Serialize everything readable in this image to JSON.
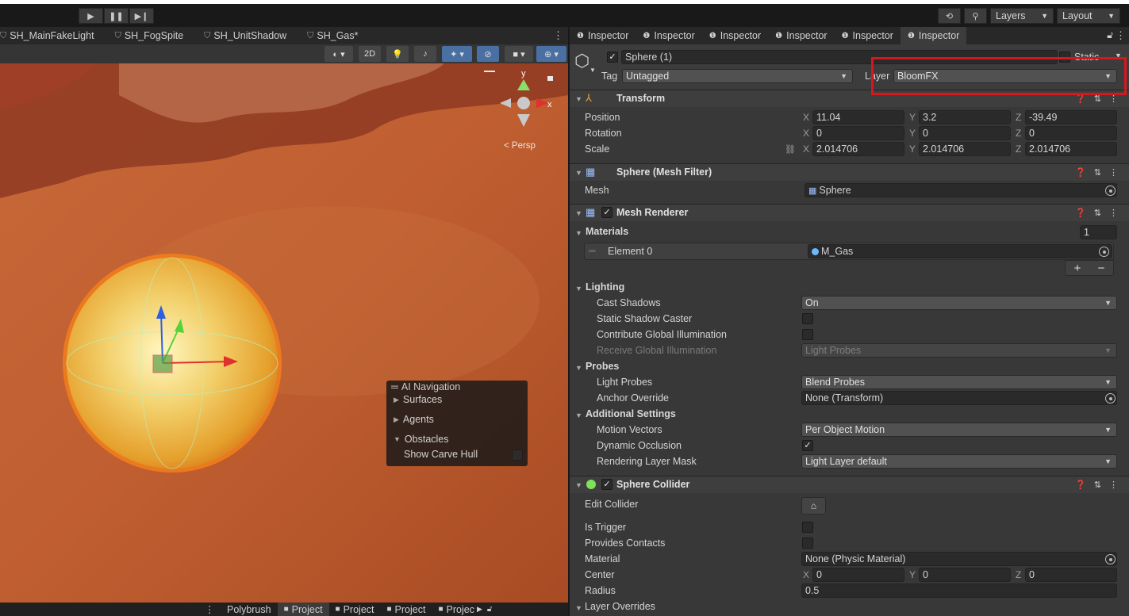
{
  "toolbar": {
    "play_icon": "play-icon",
    "pause_icon": "pause-icon",
    "step_icon": "step-icon",
    "history_icon": "history-icon",
    "search_icon": "search-icon",
    "layers_label": "Layers",
    "layout_label": "Layout"
  },
  "scene_tabs": [
    "SH_MainFakeLight",
    "SH_FogSpite",
    "SH_UnitShadow",
    "SH_Gas*"
  ],
  "scene_toolbar": {
    "mode_2d": "2D",
    "persp_label": "< Persp",
    "axis_x": "x",
    "axis_y": "y"
  },
  "ai_navigation": {
    "title": "AI Navigation",
    "items": [
      "Surfaces",
      "Agents",
      "Obstacles"
    ],
    "show_carve_hull": "Show Carve Hull"
  },
  "bottom_tabs": [
    "Polybrush",
    "Project",
    "Project",
    "Project",
    "Projec"
  ],
  "inspector": {
    "tabs": [
      "Inspector",
      "Inspector",
      "Inspector",
      "Inspector",
      "Inspector",
      "Inspector"
    ],
    "object": {
      "name": "Sphere (1)",
      "static_label": "Static",
      "tag_label": "Tag",
      "tag_value": "Untagged",
      "layer_label": "Layer",
      "layer_value": "BloomFX"
    },
    "transform": {
      "title": "Transform",
      "position_label": "Position",
      "rotation_label": "Rotation",
      "scale_label": "Scale",
      "position": {
        "x": "11.04",
        "y": "3.2",
        "z": "-39.49"
      },
      "rotation": {
        "x": "0",
        "y": "0",
        "z": "0"
      },
      "scale": {
        "x": "2.014706",
        "y": "2.014706",
        "z": "2.014706"
      }
    },
    "mesh_filter": {
      "title": "Sphere (Mesh Filter)",
      "mesh_label": "Mesh",
      "mesh_value": "Sphere"
    },
    "mesh_renderer": {
      "title": "Mesh Renderer",
      "materials_label": "Materials",
      "materials_count": "1",
      "element0_label": "Element 0",
      "element0_value": "M_Gas",
      "add_label": "+",
      "remove_label": "−",
      "lighting_label": "Lighting",
      "cast_shadows_label": "Cast Shadows",
      "cast_shadows_value": "On",
      "static_shadow_label": "Static Shadow Caster",
      "contribute_gi_label": "Contribute Global Illumination",
      "receive_gi_label": "Receive Global Illumination",
      "receive_gi_value": "Light Probes",
      "probes_label": "Probes",
      "light_probes_label": "Light Probes",
      "light_probes_value": "Blend Probes",
      "anchor_override_label": "Anchor Override",
      "anchor_override_value": "None (Transform)",
      "additional_label": "Additional Settings",
      "motion_vectors_label": "Motion Vectors",
      "motion_vectors_value": "Per Object Motion",
      "dynamic_occlusion_label": "Dynamic Occlusion",
      "rendering_layer_label": "Rendering Layer Mask",
      "rendering_layer_value": "Light Layer default"
    },
    "sphere_collider": {
      "title": "Sphere Collider",
      "edit_collider_label": "Edit Collider",
      "is_trigger_label": "Is Trigger",
      "provides_contacts_label": "Provides Contacts",
      "material_label": "Material",
      "material_value": "None (Physic Material)",
      "center_label": "Center",
      "center": {
        "x": "0",
        "y": "0",
        "z": "0"
      },
      "radius_label": "Radius",
      "radius_value": "0.5",
      "layer_overrides_label": "Layer Overrides"
    },
    "axis_letters": {
      "x": "X",
      "y": "Y",
      "z": "Z"
    }
  },
  "colors": {
    "accent": "#d8171d",
    "panel": "#383838",
    "field": "#2a2a2a"
  }
}
